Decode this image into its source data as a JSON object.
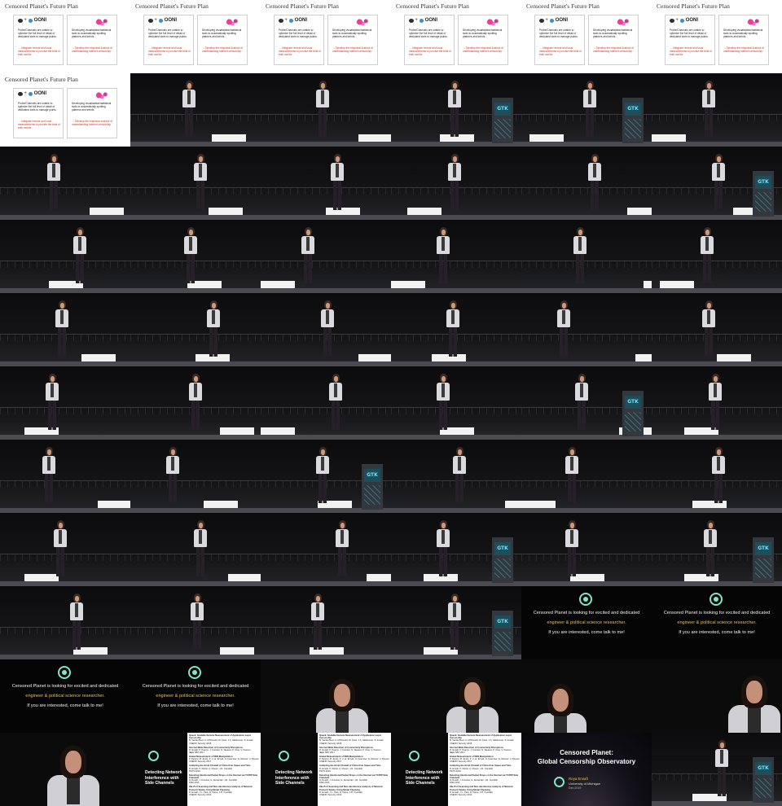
{
  "contact_sheet": {
    "columns": 6,
    "rows": 11,
    "frame_count": 66
  },
  "colors": {
    "stage_background": "#141416",
    "slide_background": "#ffffff",
    "slide_highlight_red": "#d2301e",
    "recruit_highlight_yellow": "#f1c40f",
    "logo_teal": "#7de8c8",
    "podium_screen_text": "#6ee3ff"
  },
  "frame_sequence": [
    "plan-slide",
    "plan-slide",
    "plan-slide",
    "plan-slide",
    "plan-slide",
    "plan-slide",
    "plan-slide",
    "stage",
    "stage",
    "stage",
    "stage",
    "stage",
    "stage",
    "stage",
    "stage",
    "stage",
    "stage",
    "stage",
    "stage",
    "stage",
    "stage",
    "stage",
    "stage",
    "stage",
    "stage",
    "stage",
    "stage",
    "stage",
    "stage",
    "stage",
    "stage",
    "stage",
    "stage",
    "stage",
    "stage",
    "stage",
    "stage",
    "stage",
    "stage",
    "stage",
    "stage",
    "stage",
    "stage",
    "stage",
    "stage",
    "stage",
    "stage",
    "stage",
    "stage",
    "stage",
    "stage",
    "stage",
    "recruit",
    "recruit",
    "recruit",
    "recruit",
    "closeup",
    "closeup",
    "closeup",
    "closeup",
    "closeup",
    "detect-slide",
    "detect-slide",
    "detect-slide",
    "final-slide",
    "stage"
  ],
  "plan_slide": {
    "title": "Censored Planet's Future Plan",
    "logo_text": "OONI",
    "plus_sign": "+",
    "left_text": "Probe/Channels are unable to optimize the full level of detail of dedicated tools to manage points",
    "left_highlight": "optimize the full level of detail",
    "left_action": "→ Integrate remote and local measurements to provide the best of both worlds",
    "right_text": "Developing visualization/statistical tools to automatically spotting patterns and trends",
    "right_highlight": "spotting patterns and trends",
    "right_action": "→ Develop the empirical science of understanding internet censorship"
  },
  "stage_frame": {
    "podium_screen_label": "GTK"
  },
  "recruit_frame": {
    "line1": "Censored Planet is looking for excited and dedicated",
    "line2": "engineer & political science researcher.",
    "line3": "If you are interested, come talk to me!"
  },
  "detect_slide": {
    "title": "Detecting Network Interference with Side Channels",
    "references": [
      {
        "title": "Quack: Scalable Remote Measurement of Application-Layer Censorship",
        "authors": "B. VanderSloot, A. McDonald, W. Scott, J.A. Halderman, R. Ensafi",
        "venue": "USENIX Security 2018"
      },
      {
        "title": "Internet-Wide Detection of Connectivity Disruptions",
        "authors": "R. Ensafi, P. Pearce, J. Knockel, N. Weaver, P. Vixie, V. Paxson",
        "venue": "IEEE S&P 2017"
      },
      {
        "title": "Global Measurement of DNS Manipulation",
        "authors": "P. Pearce, B. Jones, F. Li, R. Ensafi, N. Feamster, N. Weaver, V. Paxson",
        "venue": "USENIX Security 2017"
      },
      {
        "title": "Analyzing the Great Firewall of China Over Space and Time",
        "authors": "R. Ensafi, P. Winter, A. Mueen, J.R. Crandall",
        "venue": "PETS 2015"
      },
      {
        "title": "Detecting Intentional Packet Drops on the Internet via TCP/IP Side Channels",
        "authors": "R. Ensafi, J. Knockel, G. Alexander, J.R. Crandall",
        "venue": "PAM 2014"
      },
      {
        "title": "Idle Port Scanning and Non-interference Analysis of Network Protocol Stacks Using Model Checking",
        "authors": "R. Ensafi, J.C. Park, D. Kapur, J.R. Crandall",
        "venue": "USENIX Security 2010"
      }
    ]
  },
  "final_slide": {
    "title_line1": "Censored Planet:",
    "title_line2": "Global Censorship Observatory",
    "speaker_name": "Roya Ensafi",
    "affiliation": "University of Michigan",
    "date": "Dec 2019"
  }
}
